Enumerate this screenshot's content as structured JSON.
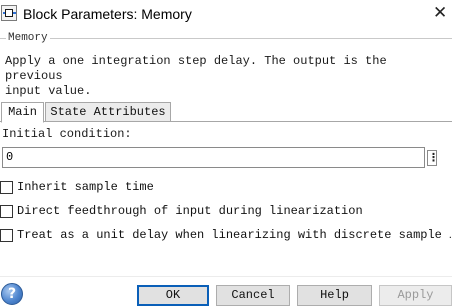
{
  "window": {
    "title": "Block Parameters: Memory",
    "close_glyph": "✕"
  },
  "group": {
    "legend": "Memory",
    "description": "Apply a one integration step delay. The output is the previous\ninput value."
  },
  "tabs": [
    {
      "label": "Main",
      "selected": true
    },
    {
      "label": "State Attributes",
      "selected": false
    }
  ],
  "main": {
    "initial_condition_label": "Initial condition:",
    "initial_condition_value": "0",
    "more_glyph": "⋮",
    "checkboxes": [
      {
        "label": "Inherit sample time",
        "checked": false
      },
      {
        "label": "Direct feedthrough of input during linearization",
        "checked": false
      },
      {
        "label": "Treat as a unit delay when linearizing with discrete sample …",
        "checked": false
      }
    ]
  },
  "footer": {
    "help_icon_glyph": "?",
    "ok_label": "OK",
    "cancel_label": "Cancel",
    "help_label": "Help",
    "apply_label": "Apply",
    "apply_enabled": false
  },
  "colors": {
    "default_button_border": "#0a5fb8",
    "disabled_text": "#9a9a9a"
  }
}
